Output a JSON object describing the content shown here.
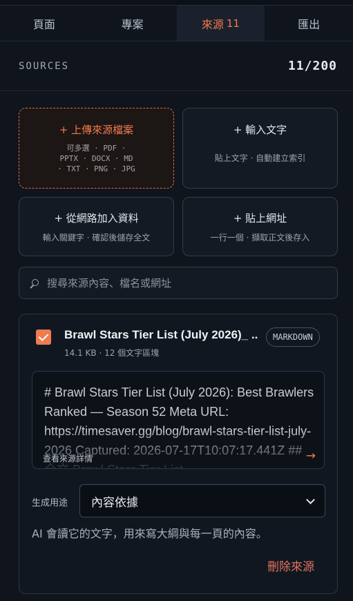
{
  "tabs": [
    {
      "label": "頁面"
    },
    {
      "label": "專案"
    },
    {
      "label": "來源",
      "count": "11"
    },
    {
      "label": "匯出"
    }
  ],
  "sources": {
    "title": "SOURCES",
    "count": "11/200"
  },
  "actions": {
    "upload": {
      "title": "+ 上傳來源檔案",
      "sub1": "可多選 · PDF ·",
      "sub2": "PPTX · DOCX · MD",
      "sub3": "· TXT · PNG · JPG"
    },
    "text": {
      "title": "+ 輸入文字",
      "sub": "貼上文字 · 自動建立索引"
    },
    "web": {
      "title": "+ 從網路加入資料",
      "sub": "輸入關鍵字 · 確認後儲存全文"
    },
    "url": {
      "title": "+ 貼上網址",
      "sub": "一行一個 · 擷取正文後存入"
    }
  },
  "search": {
    "placeholder": "搜尋來源內容、檔名或網址"
  },
  "source_item": {
    "checked": true,
    "name": "Brawl Stars Tier List (July 2026)_ ...",
    "meta": "14.1 KB · 12 個文字區塊",
    "badge": "MARKDOWN",
    "preview": "# Brawl Stars Tier List (July 2026): Best Brawlers Ranked — Season 52 Meta URL: https://timesaver.gg/blog/brawl-stars-tier-list-july-2026 Captured: 2026-07-17T10:07:17.441Z ## 全文 Brawl Stars Tier List",
    "preview_link": "查看來源詳情",
    "preview_arrow": "→",
    "purpose_label": "生成用途",
    "purpose_value": "內容依據",
    "purpose_desc": "AI 會讀它的文字，用來寫大綱與每一頁的內容。",
    "delete_label": "刪除來源"
  },
  "colors": {
    "accent": "#f07b4f",
    "background": "#0f141d",
    "danger": "#e0735e"
  }
}
